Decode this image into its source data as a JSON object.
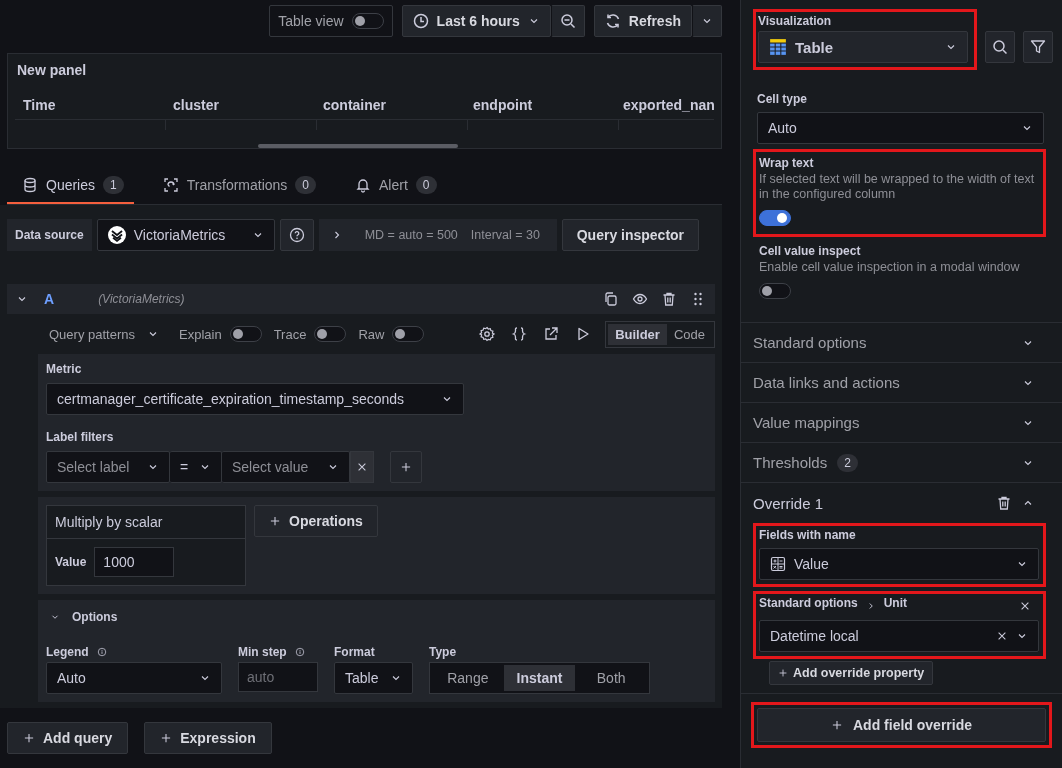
{
  "toolbar": {
    "table_view": {
      "label": "Table view",
      "on": false
    },
    "time_range": "Last 6 hours",
    "refresh": "Refresh"
  },
  "panel": {
    "title": "New panel",
    "columns": [
      "Time",
      "cluster",
      "container",
      "endpoint",
      "exported_nan"
    ]
  },
  "tabs": [
    {
      "label": "Queries",
      "count": "1",
      "selected": true
    },
    {
      "label": "Transformations",
      "count": "0",
      "selected": false
    },
    {
      "label": "Alert",
      "count": "0",
      "selected": false
    }
  ],
  "datasource": {
    "label": "Data source",
    "name": "VictoriaMetrics",
    "md": "MD = auto = 500",
    "interval": "Interval = 30",
    "inspector": "Query inspector"
  },
  "query": {
    "ref": "A",
    "source": "(VictoriaMetrics)",
    "expanded": true,
    "patterns": "Query patterns",
    "switches": [
      {
        "label": "Explain",
        "on": false
      },
      {
        "label": "Trace",
        "on": false
      },
      {
        "label": "Raw",
        "on": false
      }
    ],
    "modes": [
      {
        "label": "Builder",
        "selected": true
      },
      {
        "label": "Code",
        "selected": false
      }
    ],
    "metric_label": "Metric",
    "metric": "certmanager_certificate_expiration_timestamp_seconds",
    "label_filters_label": "Label filters",
    "filter": {
      "label_placeholder": "Select label",
      "operator": "=",
      "value_placeholder": "Select value"
    },
    "operation": {
      "title": "Multiply by scalar",
      "param_label": "Value",
      "param_value": "1000"
    },
    "operations_button": "Operations",
    "options": {
      "title": "Options",
      "expanded": true,
      "legend_label": "Legend",
      "legend": "Auto",
      "min_step_label": "Min step",
      "min_step_placeholder": "auto",
      "format_label": "Format",
      "format": "Table",
      "type_label": "Type",
      "types": [
        {
          "label": "Range",
          "selected": false
        },
        {
          "label": "Instant",
          "selected": true
        },
        {
          "label": "Both",
          "selected": false
        }
      ]
    }
  },
  "bottom_buttons": [
    "Add query",
    "Expression"
  ],
  "options_pane": {
    "visualization_label": "Visualization",
    "visualization": "Table",
    "visualization_highlighted": true,
    "cell_type_label": "Cell type",
    "cell_type": "Auto",
    "settings": [
      {
        "label": "Wrap text",
        "description": "If selected text will be wrapped to the width of text in the configured column",
        "on": true,
        "highlighted": true
      },
      {
        "label": "Cell value inspect",
        "description": "Enable cell value inspection in a modal window",
        "on": false,
        "highlighted": false
      }
    ],
    "sections": [
      {
        "title": "Standard options",
        "expanded": false
      },
      {
        "title": "Data links and actions",
        "expanded": false
      },
      {
        "title": "Value mappings",
        "expanded": false
      },
      {
        "title": "Thresholds",
        "count": "2",
        "expanded": false
      }
    ],
    "override": {
      "title": "Override 1",
      "expanded": true,
      "matcher": {
        "label": "Fields with name",
        "value": "Value",
        "highlighted": true
      },
      "property": {
        "path": [
          "Standard options",
          "Unit"
        ],
        "value": "Datetime local",
        "highlighted": true
      },
      "add_property": "Add override property"
    },
    "add_override": {
      "label": "Add field override",
      "highlighted": true
    }
  }
}
